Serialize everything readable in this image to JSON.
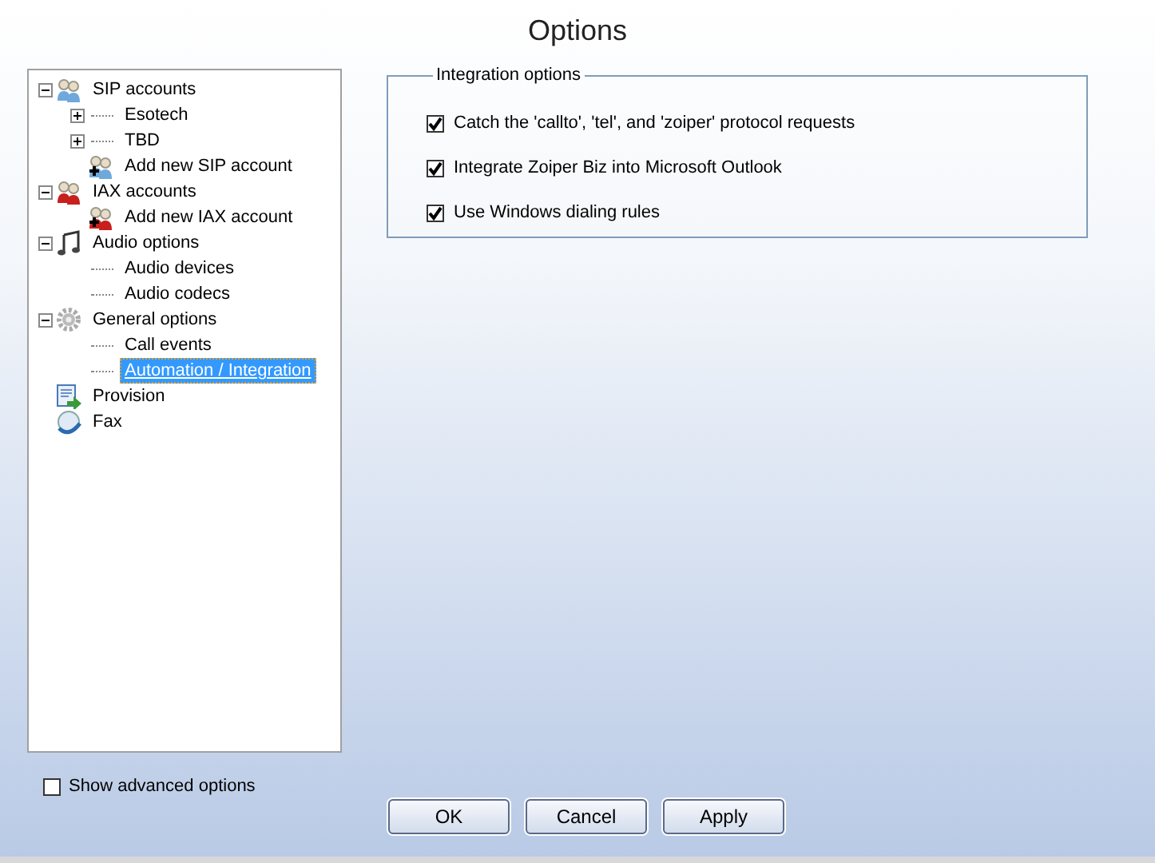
{
  "window": {
    "title": "Options"
  },
  "tree": [
    {
      "label": "SIP accounts",
      "kind": "people-blue",
      "expanded": true,
      "selected": false,
      "children": [
        {
          "label": "Esotech",
          "expanded": false,
          "selected": false
        },
        {
          "label": "TBD",
          "expanded": false,
          "selected": false
        },
        {
          "label": "Add new SIP account",
          "kind": "add-blue",
          "selected": false
        }
      ]
    },
    {
      "label": "IAX accounts",
      "kind": "people-red",
      "expanded": true,
      "selected": false,
      "children": [
        {
          "label": "Add new IAX account",
          "kind": "add-red",
          "selected": false
        }
      ]
    },
    {
      "label": "Audio options",
      "kind": "note",
      "expanded": true,
      "selected": false,
      "children": [
        {
          "label": "Audio devices",
          "selected": false
        },
        {
          "label": "Audio codecs",
          "selected": false
        }
      ]
    },
    {
      "label": "General options",
      "kind": "gear",
      "expanded": true,
      "selected": false,
      "children": [
        {
          "label": "Call events",
          "selected": false
        },
        {
          "label": "Automation / Integration",
          "selected": true
        }
      ]
    },
    {
      "label": "Provision",
      "kind": "provision",
      "selected": false
    },
    {
      "label": "Fax",
      "kind": "globe",
      "selected": false
    }
  ],
  "group": {
    "title": "Integration options",
    "options": [
      {
        "label": "Catch the 'callto', 'tel', and 'zoiper' protocol requests",
        "checked": true
      },
      {
        "label": "Integrate Zoiper Biz into Microsoft Outlook",
        "checked": true
      },
      {
        "label": "Use Windows dialing rules",
        "checked": true
      }
    ]
  },
  "advanced": {
    "label": "Show advanced options",
    "checked": false
  },
  "buttons": [
    "OK",
    "Cancel",
    "Apply"
  ]
}
